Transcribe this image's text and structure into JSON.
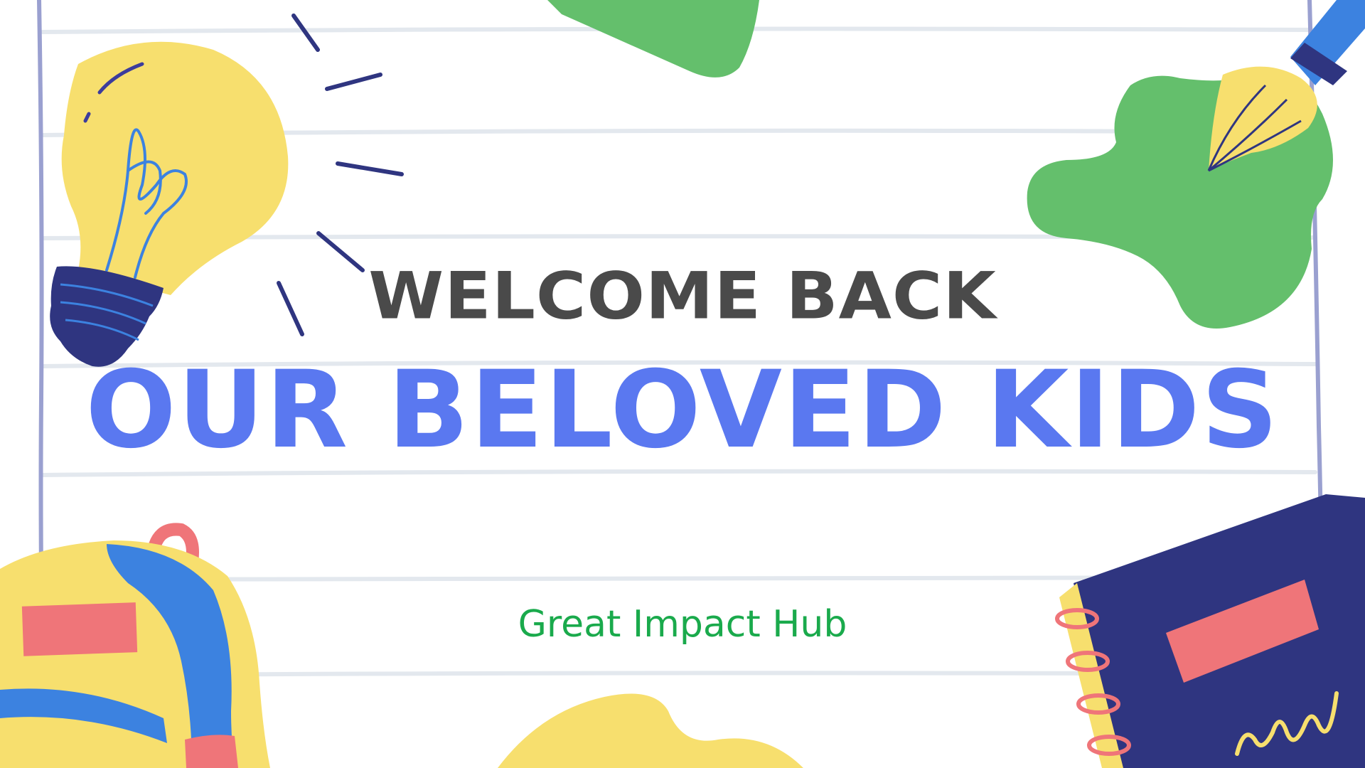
{
  "slide": {
    "heading": "WELCOME BACK",
    "subheading": "OUR BELOVED KIDS",
    "organization": "Great Impact Hub"
  },
  "colors": {
    "background": "#ffffff",
    "ruled_lines": "#e3e8ee",
    "margin_lines": "#9aa0d0",
    "heading": "#4a4a4a",
    "subheading": "#5a78f0",
    "organization": "#1aaa4c",
    "yellow": "#f7df6e",
    "green": "#64bf6c",
    "navy": "#2f3580",
    "blue": "#3c82e0",
    "coral": "#ef7579"
  },
  "decorations": [
    "lightbulb-illustration",
    "paintbrush-illustration",
    "green-paint-splash",
    "backpack-illustration",
    "notebook-illustration",
    "yellow-blob",
    "green-blob"
  ]
}
